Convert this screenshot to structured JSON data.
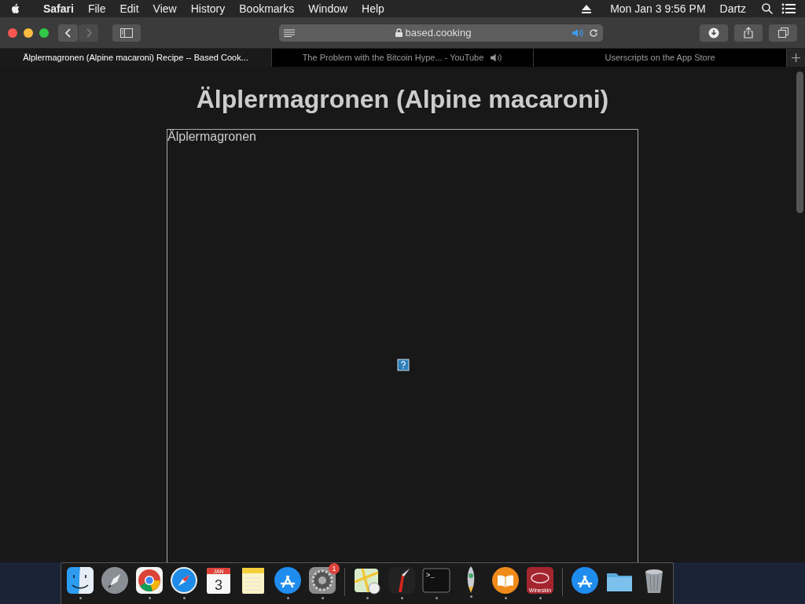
{
  "menu_bar": {
    "app_name": "Safari",
    "menus": [
      "File",
      "Edit",
      "View",
      "History",
      "Bookmarks",
      "Window",
      "Help"
    ],
    "clock": "Mon Jan 3  9:56 PM",
    "user": "Dartz"
  },
  "toolbar": {
    "address": "based.cooking",
    "audio_playing": true
  },
  "tabs": [
    {
      "label": "Älplermagronen (Alpine macaroni) Recipe -- Based Cook...",
      "selected": true,
      "audio": false
    },
    {
      "label": "The Problem with the Bitcoin Hype... - YouTube",
      "selected": false,
      "audio": true
    },
    {
      "label": "Userscripts on the App Store",
      "selected": false,
      "audio": false
    }
  ],
  "page": {
    "title": "Älplermagronen (Alpine macaroni)",
    "image_alt": "Älplermagronen"
  },
  "dock": [
    {
      "kind": "finder",
      "running": true
    },
    {
      "kind": "launchpad",
      "running": false
    },
    {
      "kind": "chrome",
      "running": true
    },
    {
      "kind": "safari",
      "running": true
    },
    {
      "kind": "calendar",
      "running": false,
      "month": "JAN",
      "day": "3"
    },
    {
      "kind": "notes",
      "running": false
    },
    {
      "kind": "appstore",
      "running": true
    },
    {
      "kind": "settings",
      "running": true,
      "badge": "1"
    },
    {
      "kind": "separator"
    },
    {
      "kind": "maps",
      "running": true
    },
    {
      "kind": "knife",
      "running": true
    },
    {
      "kind": "terminal",
      "running": true,
      "prompt": ">_"
    },
    {
      "kind": "rocket",
      "running": true
    },
    {
      "kind": "books",
      "running": true
    },
    {
      "kind": "wineskin",
      "running": true,
      "label": "Wineskin"
    },
    {
      "kind": "separator"
    },
    {
      "kind": "appstore",
      "running": false
    },
    {
      "kind": "folder",
      "running": false
    },
    {
      "kind": "trash",
      "running": false
    }
  ]
}
